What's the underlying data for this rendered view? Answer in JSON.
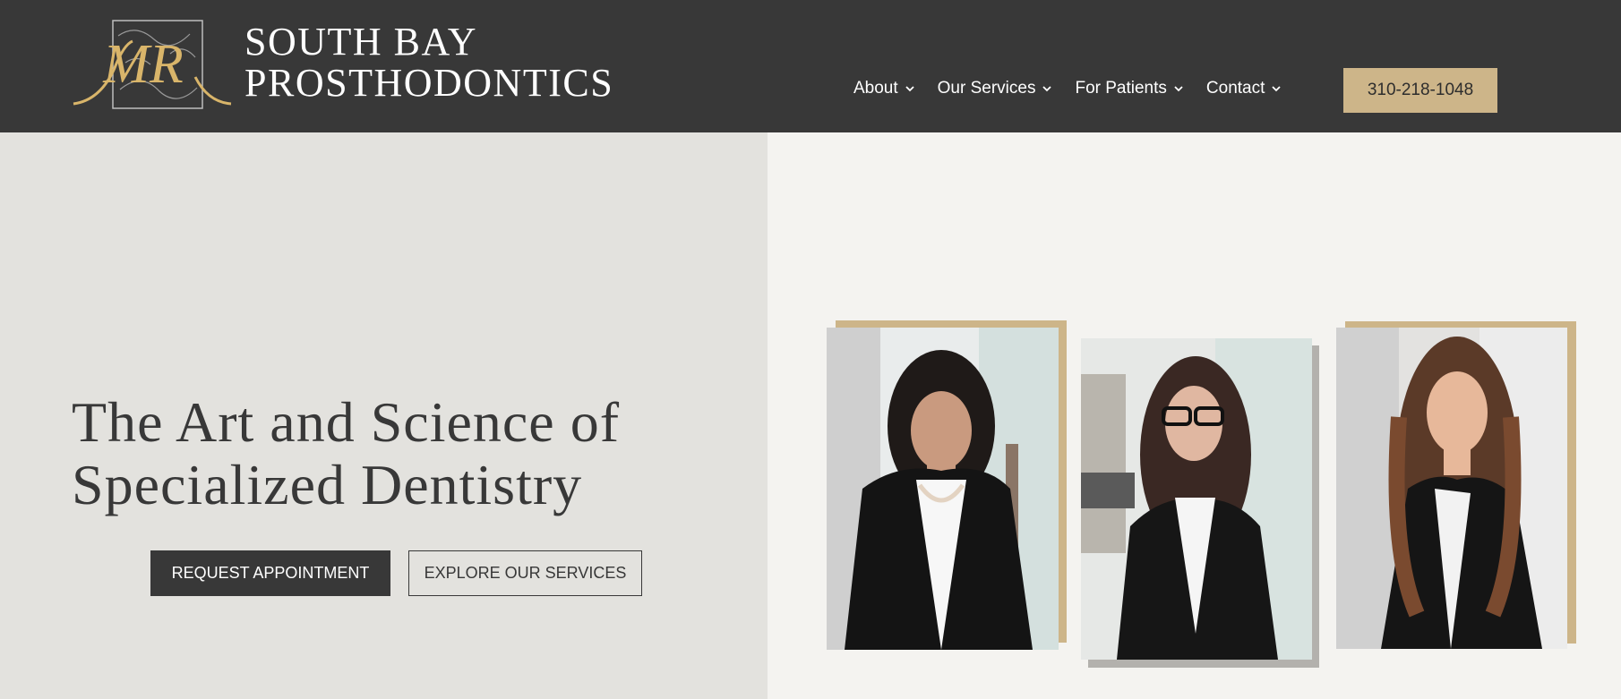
{
  "brand": {
    "monogram": "MR",
    "name_line1": "SOUTH BAY",
    "name_line2": "PROSTHODONTICS",
    "gold": "#cdb589",
    "dark": "#383838"
  },
  "nav": {
    "items": [
      {
        "label": "About",
        "icon": "chevron-down-icon"
      },
      {
        "label": "Our Services",
        "icon": "chevron-down-icon"
      },
      {
        "label": "For Patients",
        "icon": "chevron-down-icon"
      },
      {
        "label": "Contact",
        "icon": "chevron-down-icon"
      }
    ],
    "phone": "310-218-1048"
  },
  "hero": {
    "headline_line1": "The Art and Science of",
    "headline_line2": "Specialized Dentistry",
    "primary_button": "REQUEST APPOINTMENT",
    "secondary_button": "EXPLORE OUR SERVICES"
  }
}
